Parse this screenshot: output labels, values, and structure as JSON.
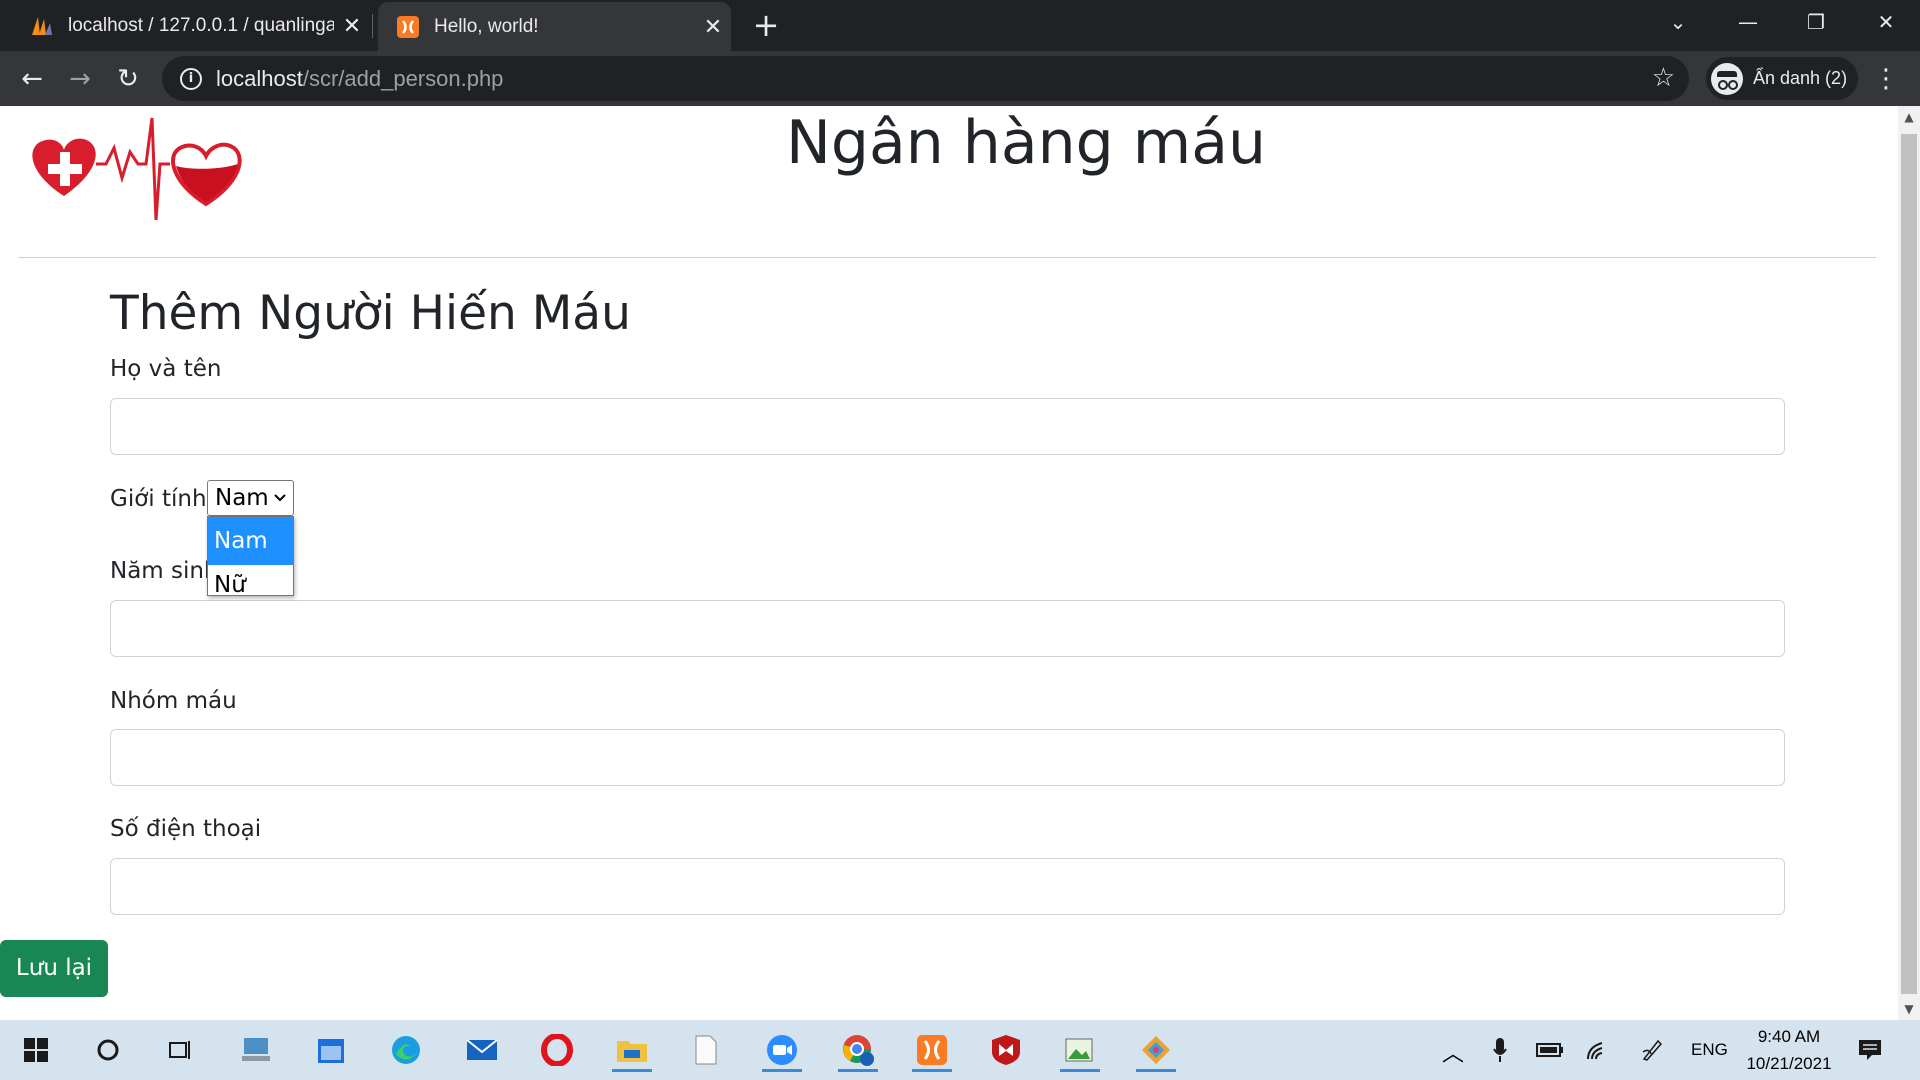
{
  "browser": {
    "tabs": [
      {
        "title": "localhost / 127.0.0.1 / quanlingan",
        "active": false,
        "favicon": "phpmyadmin-icon"
      },
      {
        "title": "Hello, world!",
        "active": true,
        "favicon": "xampp-icon"
      }
    ],
    "url_host": "localhost",
    "url_path": "/scr/add_person.php",
    "profile_label": "Ẩn danh (2)"
  },
  "page": {
    "site_title": "Ngân hàng máu",
    "form_title": "Thêm Người Hiến Máu",
    "fields": {
      "full_name_label": "Họ và tên",
      "gender_label": "Giới tính",
      "birth_year_label": "Năm sinh",
      "blood_group_label": "Nhóm máu",
      "phone_label": "Số điện thoại"
    },
    "gender_select": {
      "selected": "Nam",
      "options": [
        "Nam",
        "Nữ"
      ],
      "highlighted": "Nam"
    },
    "save_button": "Lưu lại"
  },
  "taskbar": {
    "language": "ENG",
    "time": "9:40 AM",
    "date": "10/21/2021"
  },
  "colors": {
    "save_button": "#198754",
    "dropdown_highlight": "#1e90ff",
    "chrome_dark": "#202124",
    "taskbar": "#d5e3ef"
  }
}
